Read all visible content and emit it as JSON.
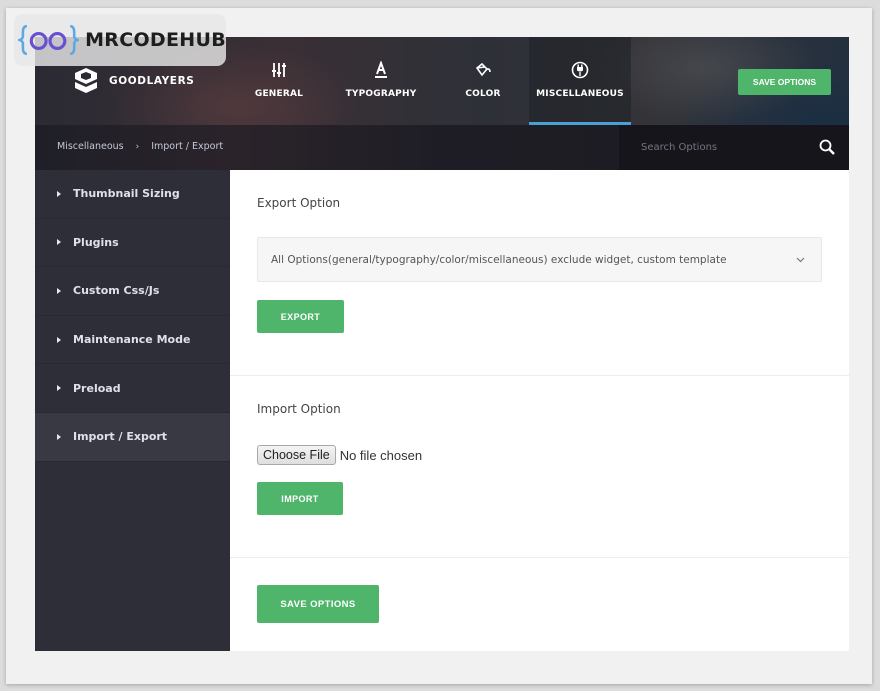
{
  "watermark": {
    "text": "MRCODEHUB",
    "icon": "code-braces-icon"
  },
  "brand": {
    "name": "GOODLAYERS",
    "icon": "goodlayers-logo-icon"
  },
  "nav": {
    "tabs": [
      {
        "label": "GENERAL",
        "icon": "sliders-icon",
        "active": false
      },
      {
        "label": "TYPOGRAPHY",
        "icon": "font-icon",
        "active": false
      },
      {
        "label": "COLOR",
        "icon": "paint-bucket-icon",
        "active": false
      },
      {
        "label": "MISCELLANEOUS",
        "icon": "plug-icon",
        "active": true
      }
    ],
    "save_label": "SAVE OPTIONS"
  },
  "breadcrumb": {
    "items": [
      "Miscellaneous",
      "Import / Export"
    ],
    "separator": "›"
  },
  "search": {
    "placeholder": "Search Options",
    "value": ""
  },
  "sidebar": {
    "items": [
      {
        "label": "Thumbnail Sizing",
        "active": false
      },
      {
        "label": "Plugins",
        "active": false
      },
      {
        "label": "Custom Css/Js",
        "active": false
      },
      {
        "label": "Maintenance Mode",
        "active": false
      },
      {
        "label": "Preload",
        "active": false
      },
      {
        "label": "Import / Export",
        "active": true
      }
    ]
  },
  "export": {
    "title": "Export Option",
    "selected_option": "All Options(general/typography/color/miscellaneous) exclude widget, custom template",
    "button_label": "EXPORT"
  },
  "import": {
    "title": "Import Option",
    "choose_file_label": "Choose File",
    "file_status": "No file chosen",
    "button_label": "IMPORT"
  },
  "footer": {
    "save_label": "SAVE OPTIONS"
  },
  "colors": {
    "accent_green": "#4fb56b",
    "active_tab_underline": "#4a9fd5",
    "sidebar_bg": "#2e2e39",
    "sidebar_active_bg": "#393944"
  }
}
